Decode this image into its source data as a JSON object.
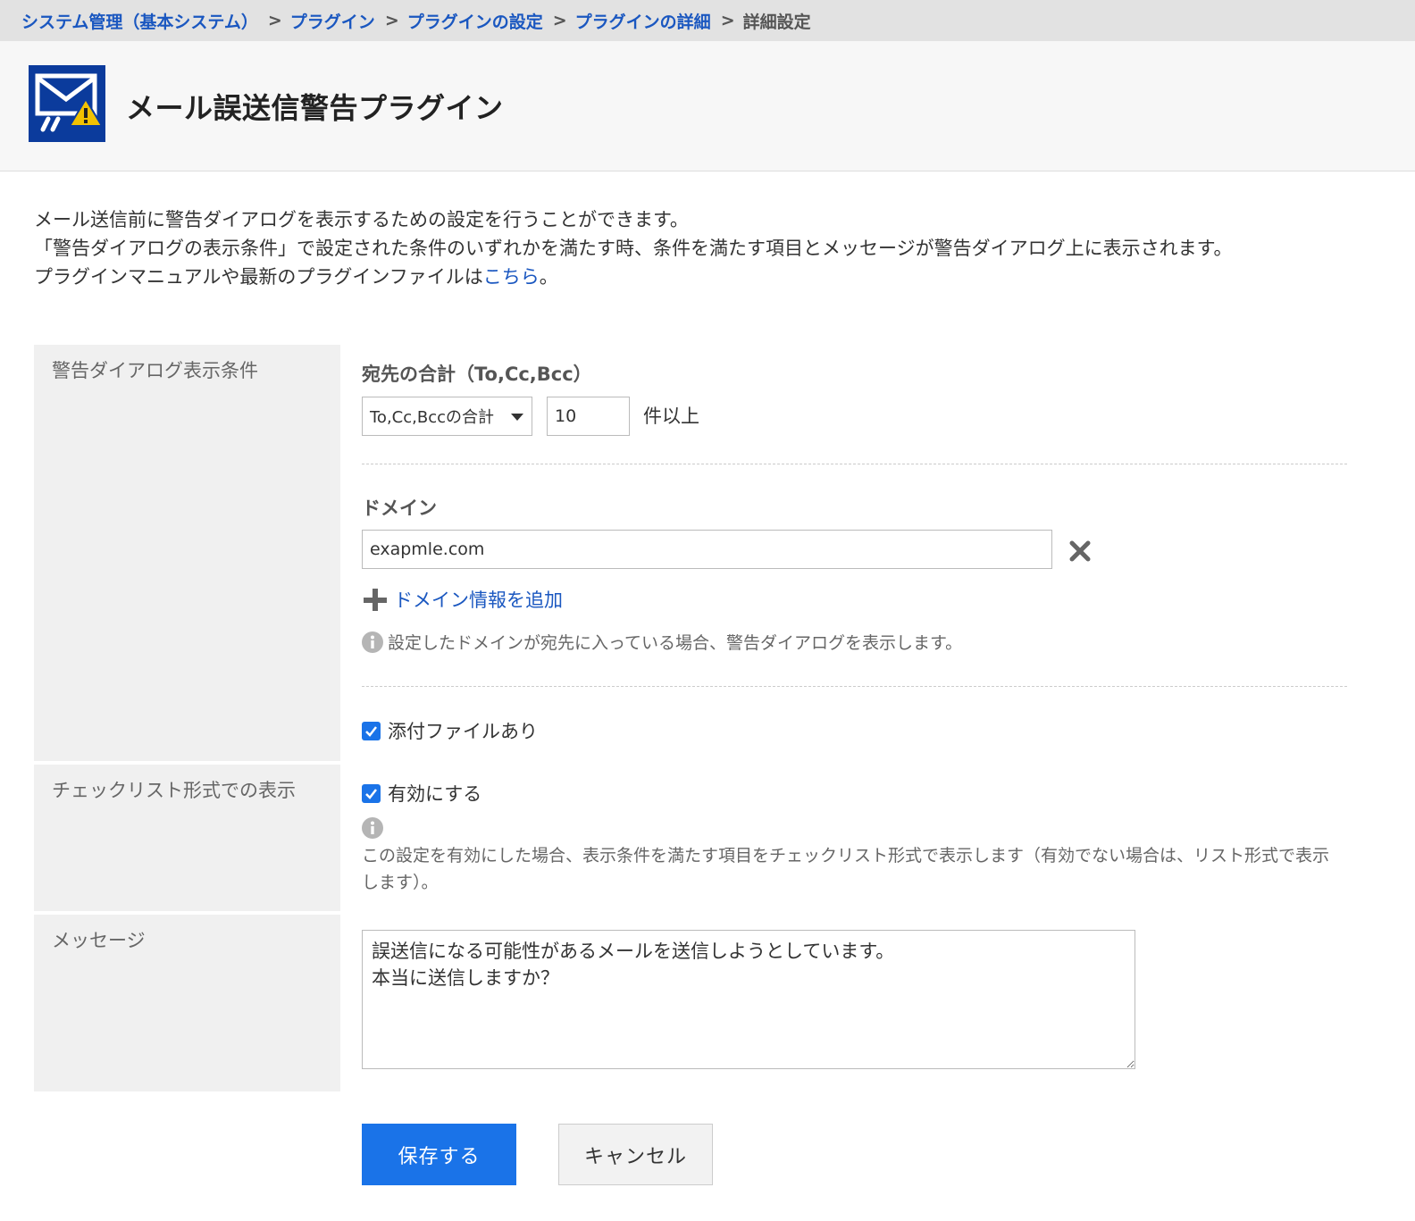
{
  "breadcrumb": {
    "items": [
      "システム管理（基本システム）",
      "プラグイン",
      "プラグインの設定",
      "プラグインの詳細"
    ],
    "separator": ">",
    "current": "詳細設定"
  },
  "header": {
    "title": "メール誤送信警告プラグイン",
    "logo_icon": "mail-warning-icon"
  },
  "description": {
    "line1": "メール送信前に警告ダイアログを表示するための設定を行うことができます。",
    "line2": "「警告ダイアログの表示条件」で設定された条件のいずれかを満たす時、条件を満たす項目とメッセージが警告ダイアログ上に表示されます。",
    "line3_prefix": "プラグインマニュアルや最新のプラグインファイルは",
    "link_text": "こちら",
    "line3_suffix": "。"
  },
  "rows": {
    "conditions_label": "警告ダイアログ表示条件",
    "checklist_label": "チェックリスト形式での表示",
    "message_label": "メッセージ"
  },
  "recipients": {
    "title": "宛先の合計（To,Cc,Bcc）",
    "select_value": "To,Cc,Bccの合計",
    "count_value": "10",
    "unit": "件以上"
  },
  "domain": {
    "title": "ドメイン",
    "value": "exapmle.com",
    "add_label": "ドメイン情報を追加",
    "hint": "設定したドメインが宛先に入っている場合、警告ダイアログを表示します。"
  },
  "attachment": {
    "label": "添付ファイルあり",
    "checked": true
  },
  "checklist": {
    "label": "有効にする",
    "checked": true,
    "note": "この設定を有効にした場合、表示条件を満たす項目をチェックリスト形式で表示します（有効でない場合は、リスト形式で表示します）。"
  },
  "message": {
    "value": "誤送信になる可能性があるメールを送信しようとしています。\n本当に送信しますか？"
  },
  "buttons": {
    "save": "保存する",
    "cancel": "キャンセル"
  },
  "colors": {
    "link": "#1a57c0",
    "primary": "#1a73e8",
    "logo_bg": "#0b3b9c",
    "warning": "#f2c200"
  }
}
